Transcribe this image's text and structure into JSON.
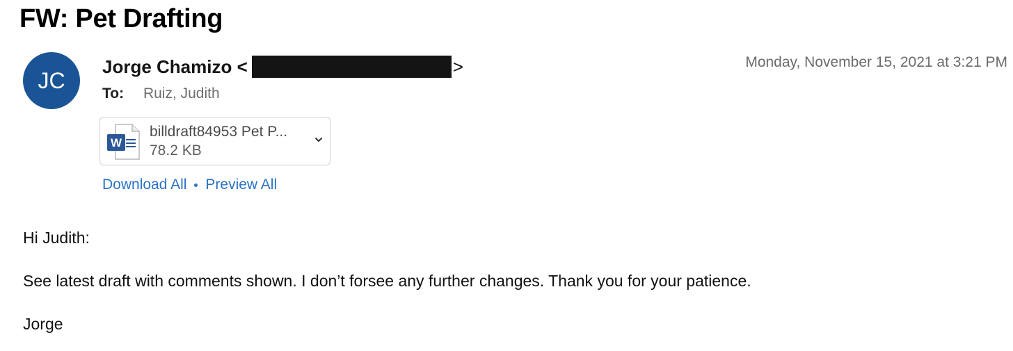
{
  "email": {
    "subject": "FW: Pet Drafting",
    "avatar_initials": "JC",
    "avatar_color": "#1a5497",
    "sender_name": "Jorge Chamizo <",
    "sender_close": ">",
    "timestamp": "Monday, November 15, 2021 at 3:21 PM",
    "to_label": "To:",
    "to_value": "Ruiz, Judith"
  },
  "attachment": {
    "icon": "word-document-icon",
    "name": "billdraft84953 Pet P...",
    "size": "78.2 KB",
    "menu_icon": "chevron-down-icon"
  },
  "actions": {
    "download_all": "Download All",
    "preview_all": "Preview All",
    "link_color": "#2b73c5"
  },
  "body": {
    "greeting": "Hi Judith:",
    "message": "See latest draft with comments shown. I don’t forsee any further changes.  Thank you for your patience.",
    "signature": "Jorge"
  }
}
